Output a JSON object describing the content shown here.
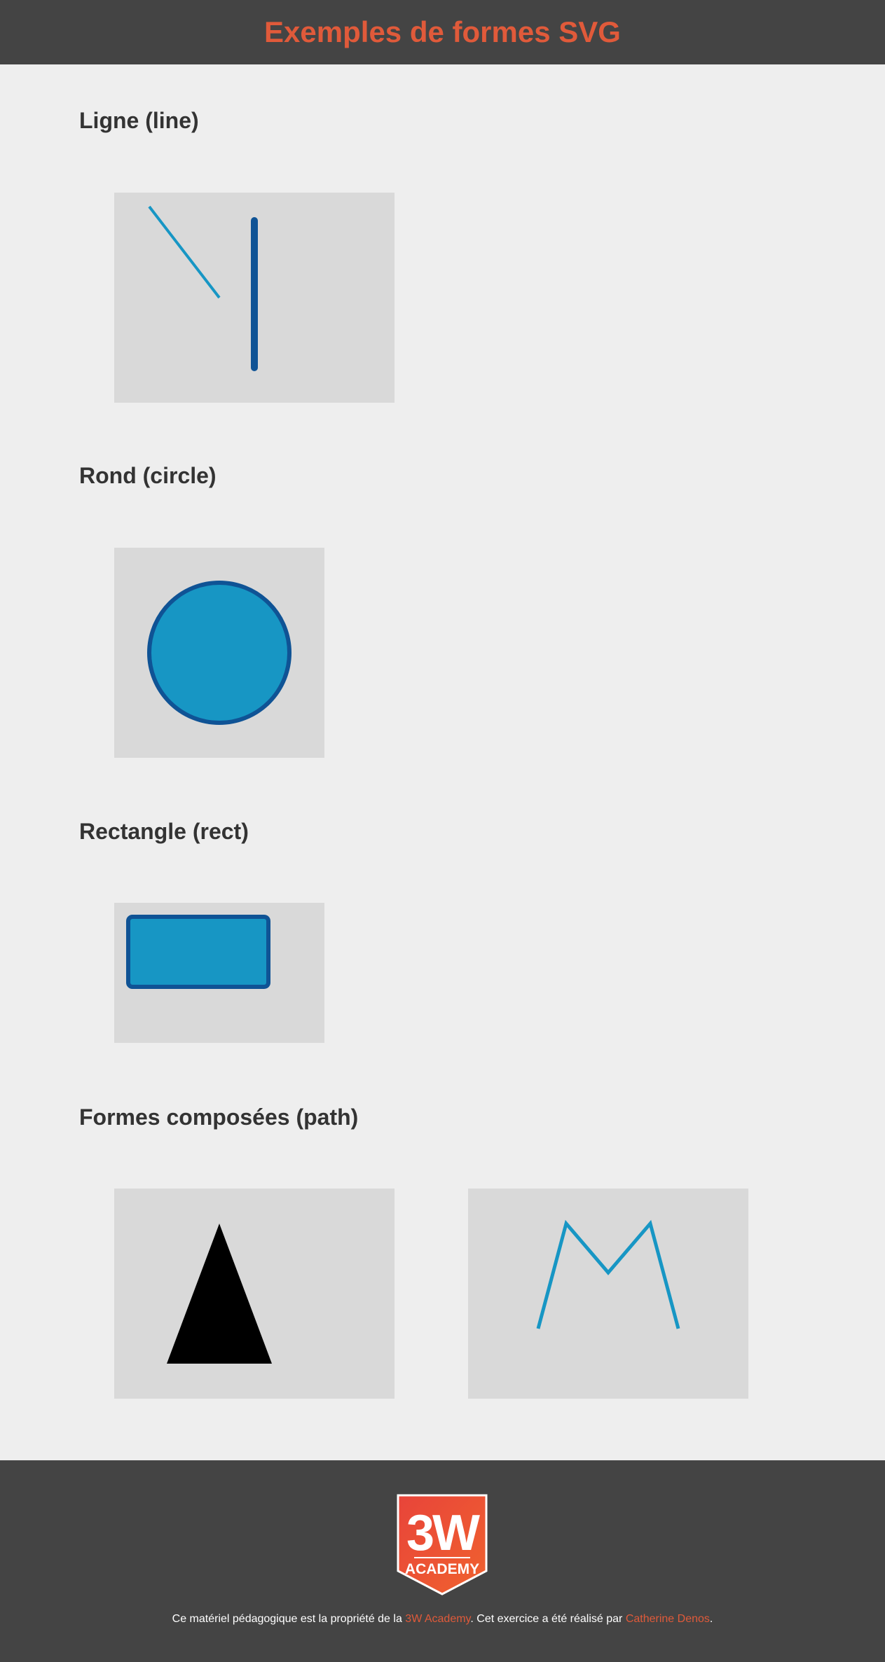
{
  "header": {
    "title": "Exemples de formes SVG"
  },
  "sections": [
    {
      "title": "Ligne (line)"
    },
    {
      "title": "Rond (circle)"
    },
    {
      "title": "Rectangle (rect)"
    },
    {
      "title": "Formes composées (path)"
    }
  ],
  "colors": {
    "accent": "#e05a3a",
    "shape_fill": "#1796c4",
    "shape_stroke": "#0f5395",
    "box_bg": "#d9d9d9",
    "page_bg": "#eeeeee",
    "bar_bg": "#444444"
  },
  "footer": {
    "logo_text_top": "3W",
    "logo_text_bottom": "ACADEMY",
    "credits_prefix": "Ce matériel pédagogique est la propriété de la ",
    "academy_link": "3W Academy",
    "credits_middle": ". Cet exercice a été réalisé par ",
    "author_link": "Catherine Denos",
    "credits_suffix": "."
  }
}
